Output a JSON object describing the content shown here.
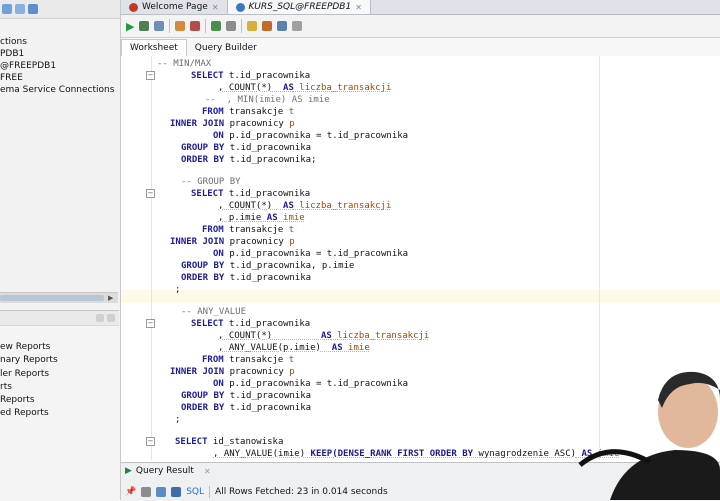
{
  "left_panel": {
    "connections": [
      "ctions",
      "PDB1",
      "@FREEPDB1",
      "FREE",
      "ema Service Connections"
    ],
    "reports": [
      "ew Reports",
      "nary Reports",
      "ler Reports",
      "rts",
      "Reports",
      "ed Reports"
    ]
  },
  "tabs": [
    {
      "label": "Welcome Page"
    },
    {
      "label": "KURS_SQL@FREEPDB1"
    }
  ],
  "worksheet": {
    "tab_worksheet": "Worksheet",
    "tab_query_builder": "Query Builder"
  },
  "code": {
    "l01": "-- MIN/MAX",
    "l02a": "SELECT",
    "l02b": " t.id_pracownika",
    "l03a": ", COUNT(*)",
    "l03b": "  AS",
    "l03c": " liczba_transakcji",
    "l04": "--  , MIN(imie) AS imie",
    "l05a": "FROM",
    "l05b": " transakcje",
    "l05c": " t",
    "l06a": "INNER JOIN",
    "l06b": " pracownicy",
    "l06c": " p",
    "l07a": "ON",
    "l07b": " p.id_pracownika = t.id_pracownika",
    "l08a": "GROUP BY",
    "l08b": " t.id_pracownika",
    "l09a": "ORDER BY",
    "l09b": " t.id_pracownika;",
    "l10": "-- GROUP BY",
    "l11a": "SELECT",
    "l11b": " t.id_pracownika",
    "l12a": ", COUNT(*)",
    "l12b": "  AS",
    "l12c": " liczba_transakcji",
    "l13a": ", p.imie",
    "l13b": " AS",
    "l13c": " imie",
    "l14a": "FROM",
    "l14b": " transakcje",
    "l14c": " t",
    "l15a": "INNER JOIN",
    "l15b": " pracownicy",
    "l15c": " p",
    "l16a": "ON",
    "l16b": " p.id_pracownika = t.id_pracownika",
    "l17a": "GROUP BY",
    "l17b": " t.id_pracownika, p.imie",
    "l18a": "ORDER BY",
    "l18b": " t.id_pracownika",
    "l19": ";",
    "l20": "-- ANY_VALUE",
    "l21a": "SELECT",
    "l21b": " t.id_pracownika",
    "l22a": ", COUNT(*)",
    "l22b": "         AS",
    "l22c": " liczba_transakcji",
    "l23a": ", ANY_VALUE(p.imie)",
    "l23b": "  AS",
    "l23c": " imie",
    "l24a": "FROM",
    "l24b": " transakcje",
    "l24c": " t",
    "l25a": "INNER JOIN",
    "l25b": " pracownicy",
    "l25c": " p",
    "l26a": "ON",
    "l26b": " p.id_pracownika = t.id_pracownika",
    "l27a": "GROUP BY",
    "l27b": " t.id_pracownika",
    "l28a": "ORDER BY",
    "l28b": " t.id_pracownika",
    "l29": ";",
    "l30a": "SELECT",
    "l30b": " id_stanowiska",
    "l31a": ", ANY_VALUE(imie)",
    "l31b": " KEEP(DENSE_RANK FIRST ORDER BY",
    "l31c": " wynagrodzenie ASC)",
    "l31d": " AS",
    "l31e": " imie"
  },
  "results": {
    "tab_label": "Query Result",
    "sql_label": "SQL",
    "status": "All Rows Fetched: 23 in 0.014 seconds"
  }
}
